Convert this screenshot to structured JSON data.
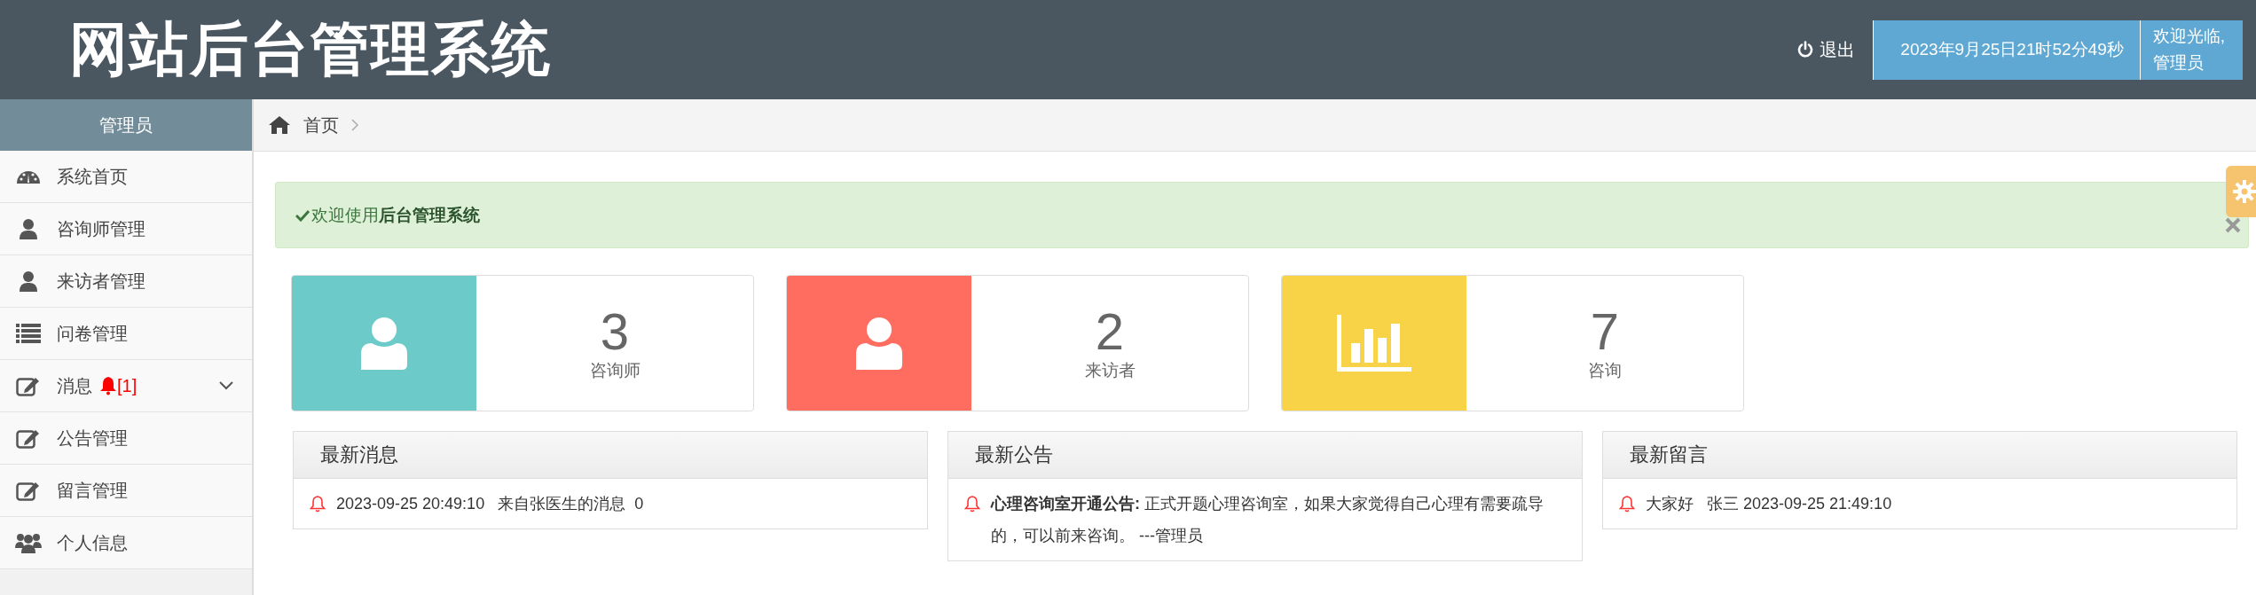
{
  "header": {
    "title": "网站后台管理系统",
    "logout": "退出",
    "datetime": "2023年9月25日21时52分49秒",
    "welcome": "欢迎光临,",
    "user": "管理员"
  },
  "sidebar": {
    "title": "管理员",
    "items": [
      {
        "label": "系统首页",
        "kind": "dashboard"
      },
      {
        "label": "咨询师管理",
        "kind": "user"
      },
      {
        "label": "来访者管理",
        "kind": "user"
      },
      {
        "label": "问卷管理",
        "kind": "list"
      },
      {
        "label": "消息",
        "kind": "edit",
        "badge": "[1]",
        "expanded": false
      },
      {
        "label": "公告管理",
        "kind": "edit"
      },
      {
        "label": "留言管理",
        "kind": "edit"
      },
      {
        "label": "个人信息",
        "kind": "group"
      }
    ]
  },
  "breadcrumb": [
    "首页"
  ],
  "alert": {
    "text": "欢迎使用**后台管理系统**"
  },
  "stats": [
    {
      "kind": "person",
      "color": "#6ccbc9",
      "value": "3",
      "label": "咨询师"
    },
    {
      "kind": "person",
      "color": "#ff6c60",
      "value": "2",
      "label": "来访者"
    },
    {
      "kind": "chart",
      "color": "#f8d347",
      "value": "7",
      "label": "咨询"
    }
  ],
  "panels": [
    {
      "title": "最新消息",
      "items": [
        "2023-09-25 20:49:10   来自张医生的消息  0"
      ]
    },
    {
      "title": "最新公告",
      "items": [
        "**心理咨询室开通公告:** 正式开题心理咨询室，如果大家觉得自己心理有需要疏导的，可以前来咨询。 ---管理员"
      ]
    },
    {
      "title": "最新留言",
      "items": [
        "大家好   张三 2023-09-25 21:49:10"
      ]
    }
  ]
}
